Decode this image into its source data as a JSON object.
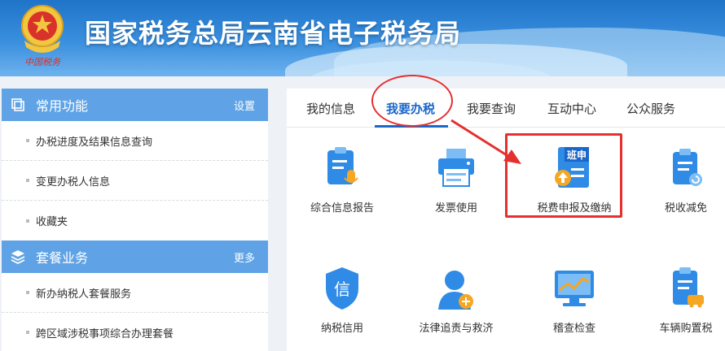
{
  "header": {
    "title": "国家税务总局云南省电子税务局",
    "emblem_caption": "中国税务"
  },
  "sections": [
    {
      "title": "常用功能",
      "icon": "window-icon",
      "link": "设置",
      "items": [
        "办税进度及结果信息查询",
        "变更办税人信息",
        "收藏夹"
      ]
    },
    {
      "title": "套餐业务",
      "icon": "layers-icon",
      "link": "更多",
      "items": [
        "新办纳税人套餐服务",
        "跨区域涉税事项综合办理套餐"
      ]
    }
  ],
  "tabs": [
    {
      "label": "我的信息",
      "active": false
    },
    {
      "label": "我要办税",
      "active": true
    },
    {
      "label": "我要查询",
      "active": false
    },
    {
      "label": "互动中心",
      "active": false
    },
    {
      "label": "公众服务",
      "active": false
    }
  ],
  "services": [
    {
      "label": "综合信息报告",
      "icon": "report-mic-icon"
    },
    {
      "label": "发票使用",
      "icon": "printer-icon"
    },
    {
      "label": "税费申报及缴纳",
      "icon": "tax-filing-icon",
      "icon_text": "班申"
    },
    {
      "label": "税收减免",
      "icon": "tax-reduction-icon"
    },
    {
      "label": "纳税信用",
      "icon": "credit-shield-icon",
      "icon_text": "信"
    },
    {
      "label": "法律追责与救济",
      "icon": "judge-icon"
    },
    {
      "label": "稽查检查",
      "icon": "monitor-chart-icon"
    },
    {
      "label": "车辆购置税",
      "icon": "vehicle-tax-icon"
    }
  ],
  "colors": {
    "accent": "#1a66c9",
    "section_header": "#5fa3e6",
    "annotation": "#e53030",
    "icon_blue": "#2f8be6",
    "icon_orange": "#f5a623"
  }
}
